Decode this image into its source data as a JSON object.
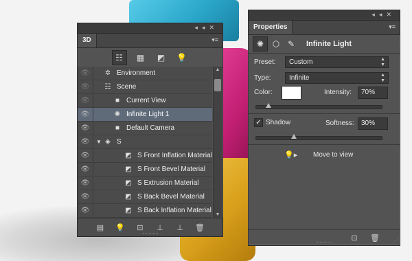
{
  "panel3d": {
    "tab": "3D",
    "filter_icons": [
      "scene-filter-icon",
      "mesh-filter-icon",
      "material-filter-icon",
      "light-filter-icon"
    ],
    "rows": [
      {
        "label": "Environment",
        "icon": "environment-icon",
        "indent": 0
      },
      {
        "label": "Scene",
        "icon": "scene-icon",
        "indent": 0
      },
      {
        "label": "Current View",
        "icon": "camera-icon",
        "indent": 1
      },
      {
        "label": "Infinite Light 1",
        "icon": "infinite-light-icon",
        "indent": 1,
        "selected": true
      },
      {
        "label": "Default Camera",
        "icon": "camera-icon",
        "indent": 1
      },
      {
        "label": "S",
        "icon": "mesh-icon",
        "indent": 0,
        "expanded": true
      },
      {
        "label": "S Front Inflation Material",
        "icon": "material-icon",
        "indent": 2
      },
      {
        "label": "S Front Bevel Material",
        "icon": "material-icon",
        "indent": 2
      },
      {
        "label": "S Extrusion Material",
        "icon": "material-icon",
        "indent": 2
      },
      {
        "label": "S Back Bevel Material",
        "icon": "material-icon",
        "indent": 2
      },
      {
        "label": "S Back Inflation Material",
        "icon": "material-icon",
        "indent": 2
      }
    ],
    "bottom_icons": [
      "filter-icon",
      "add-light-icon",
      "add-mesh-icon",
      "render-icon",
      "shadow-icon",
      "trash-icon"
    ]
  },
  "properties": {
    "tab": "Properties",
    "title": "Infinite Light",
    "preset_label": "Preset:",
    "preset_value": "Custom",
    "type_label": "Type:",
    "type_value": "Infinite",
    "color_label": "Color:",
    "color_value": "#ffffff",
    "intensity_label": "Intensity:",
    "intensity_value": "70%",
    "intensity_fraction": 0.1,
    "shadow_label": "Shadow",
    "shadow_checked": true,
    "softness_label": "Softness:",
    "softness_value": "30%",
    "softness_fraction": 0.3,
    "move_to_view": "Move to view"
  },
  "colors": {
    "panel_bg": "#535353",
    "selected_row": "#606b7a",
    "scene_cyan": "#2aa6c9",
    "scene_magenta": "#c21f73",
    "scene_yellow": "#d9a11b"
  }
}
